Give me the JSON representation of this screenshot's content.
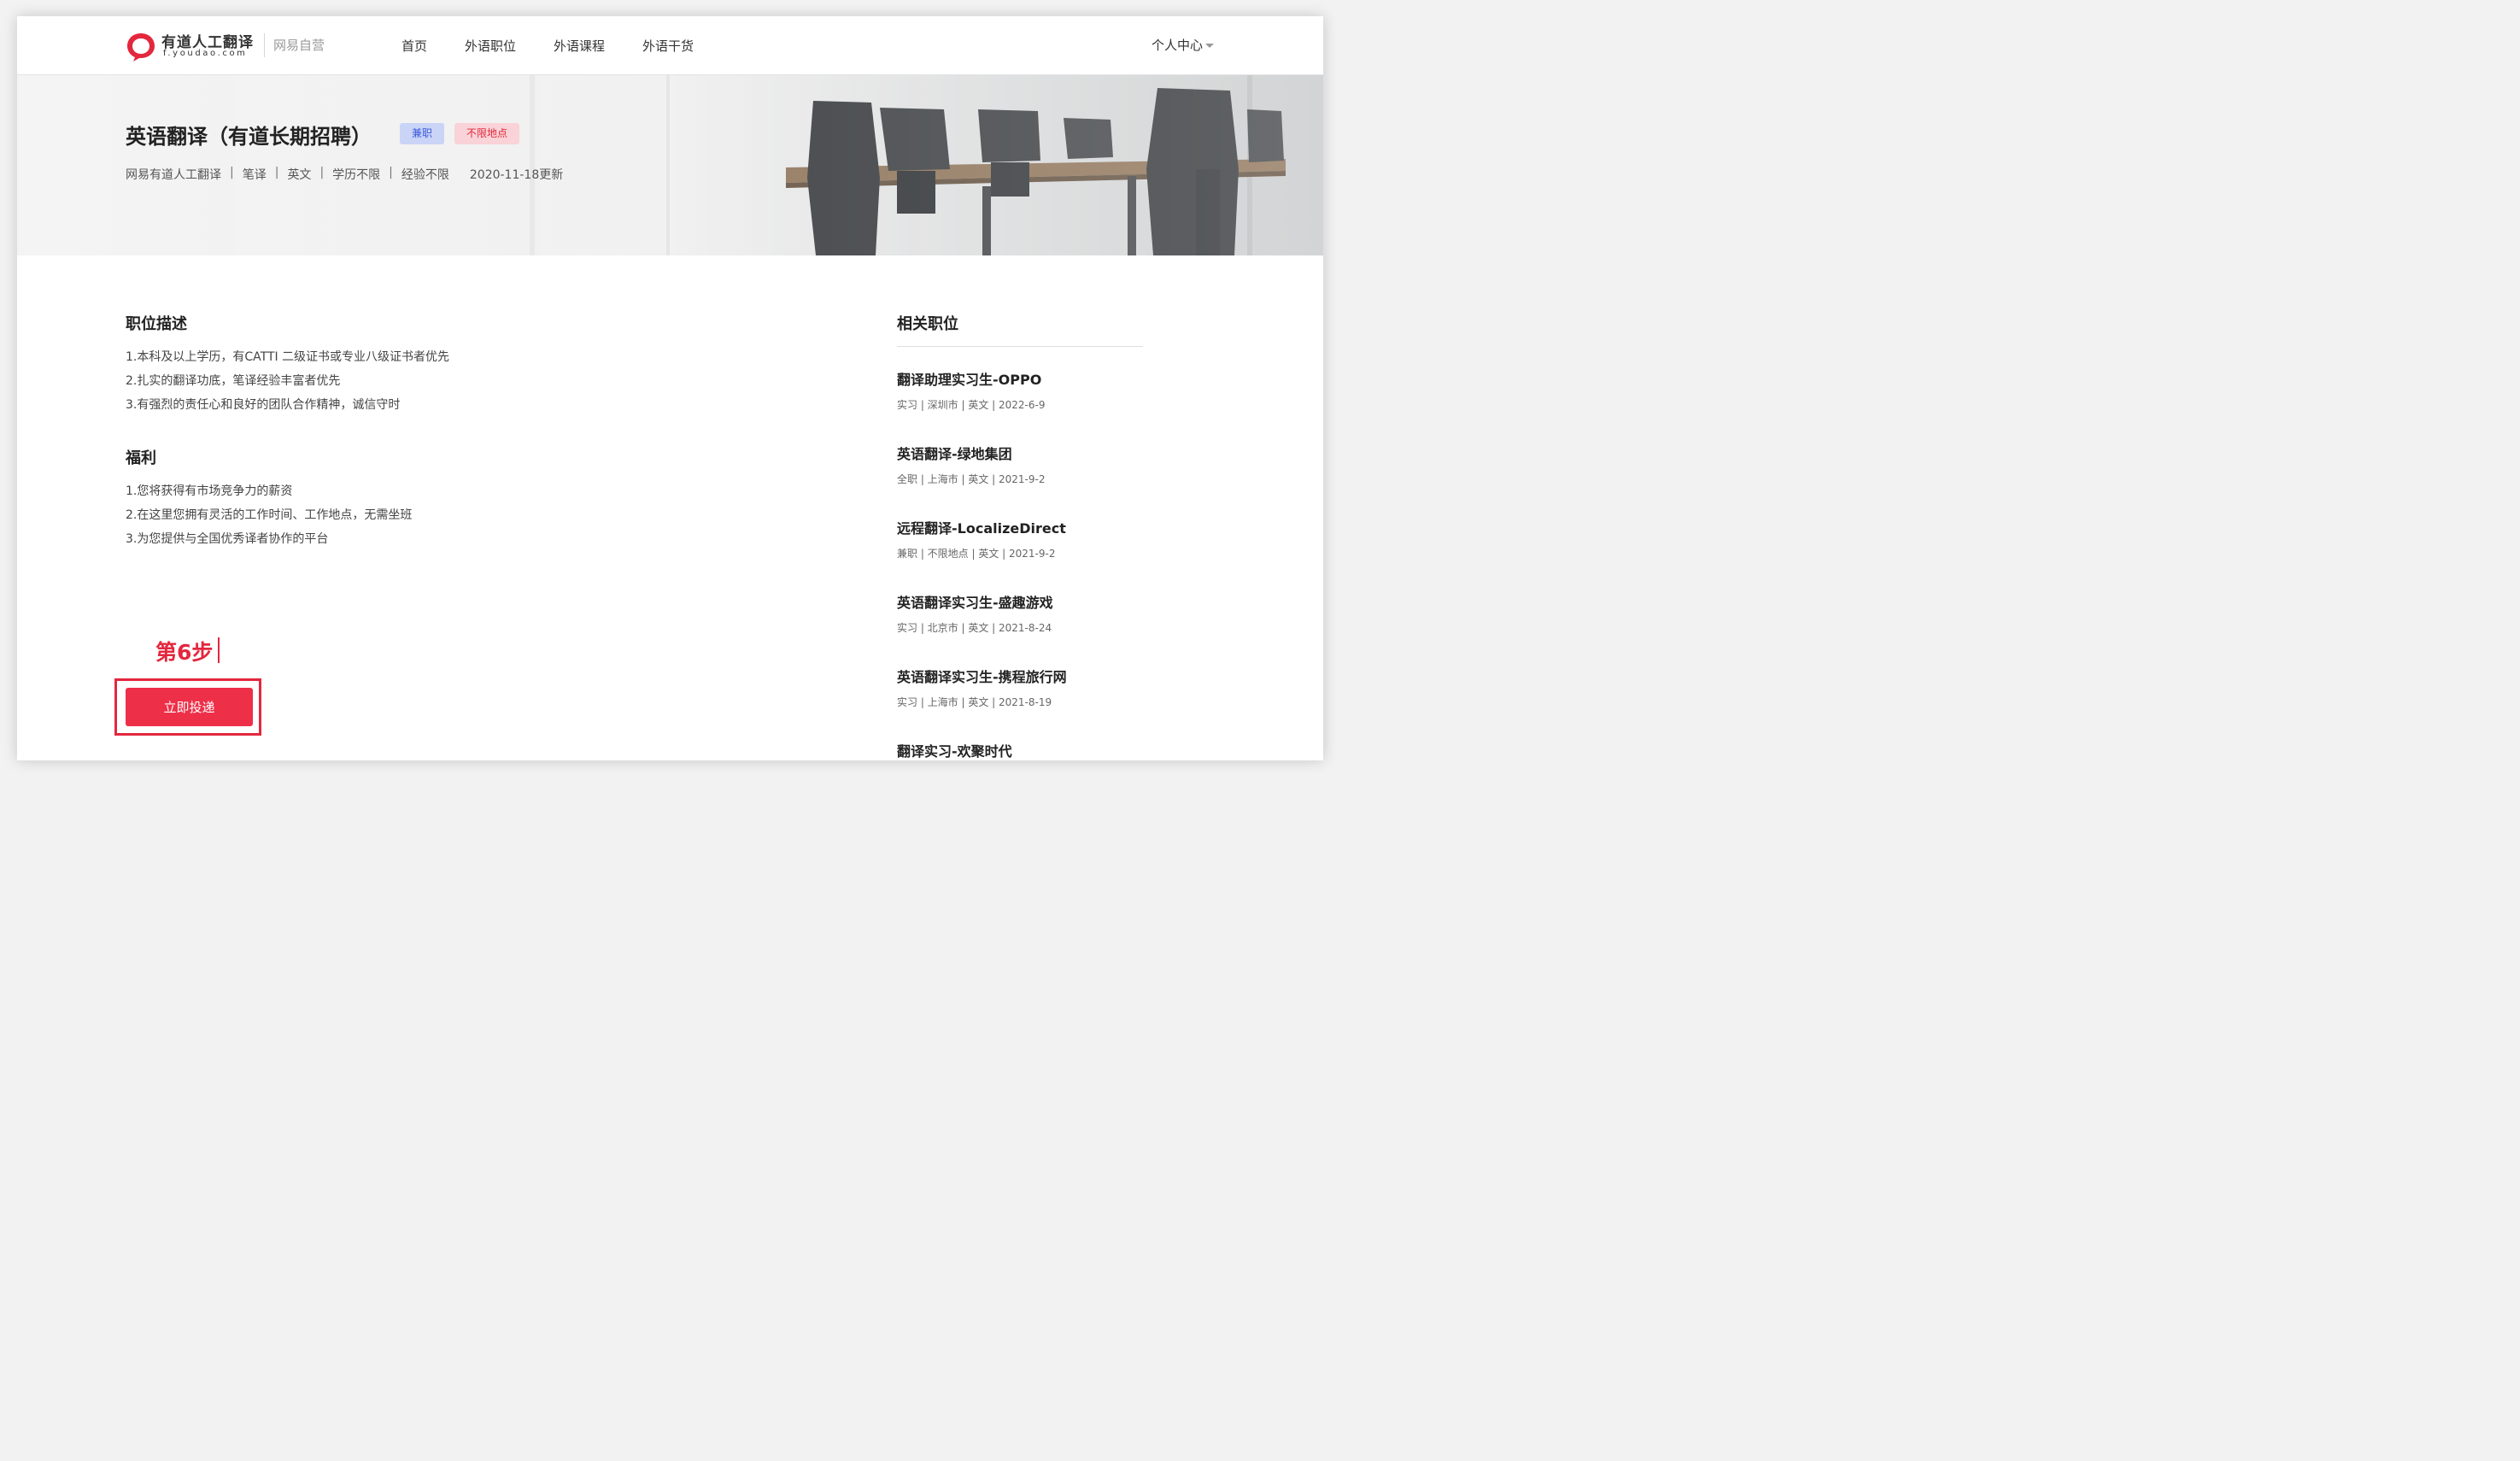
{
  "header": {
    "logo_name": "有道人工翻译",
    "logo_domain": "f.youdao.com",
    "logo_sub": "网易自营",
    "nav": [
      "首页",
      "外语职位",
      "外语课程",
      "外语干货"
    ],
    "user_center": "个人中心"
  },
  "job": {
    "title": "英语翻译（有道长期招聘）",
    "tags": [
      "兼职",
      "不限地点"
    ],
    "meta": [
      "网易有道人工翻译",
      "笔译",
      "英文",
      "学历不限",
      "经验不限"
    ],
    "updated": "2020-11-18更新"
  },
  "description": {
    "title": "职位描述",
    "items": [
      "1.本科及以上学历，有CATTI 二级证书或专业八级证书者优先",
      "2.扎实的翻译功底，笔译经验丰富者优先",
      "3.有强烈的责任心和良好的团队合作精神，诚信守时"
    ]
  },
  "benefits": {
    "title": "福利",
    "items": [
      "1.您将获得有市场竞争力的薪资",
      "2.在这里您拥有灵活的工作时间、工作地点，无需坐班",
      "3.为您提供与全国优秀译者协作的平台"
    ]
  },
  "annotation": {
    "step_label": "第6步"
  },
  "apply_label": "立即投递",
  "related": {
    "title": "相关职位",
    "items": [
      {
        "name": "翻译助理实习生-OPPO",
        "meta": "实习 | 深圳市 | 英文 | 2022-6-9"
      },
      {
        "name": "英语翻译-绿地集团",
        "meta": "全职 | 上海市 | 英文 | 2021-9-2"
      },
      {
        "name": "远程翻译-LocalizeDirect",
        "meta": "兼职 | 不限地点 | 英文 | 2021-9-2"
      },
      {
        "name": "英语翻译实习生-盛趣游戏",
        "meta": "实习 | 北京市 | 英文 | 2021-8-24"
      },
      {
        "name": "英语翻译实习生-携程旅行网",
        "meta": "实习 | 上海市 | 英文 | 2021-8-19"
      },
      {
        "name": "翻译实习-欢聚时代",
        "meta": ""
      }
    ]
  },
  "colors": {
    "brand_red": "#ee2f48",
    "annotation_red": "#e3273d",
    "tag_blue_bg": "#c9d4f7",
    "tag_red_bg": "#f9d3d7"
  }
}
